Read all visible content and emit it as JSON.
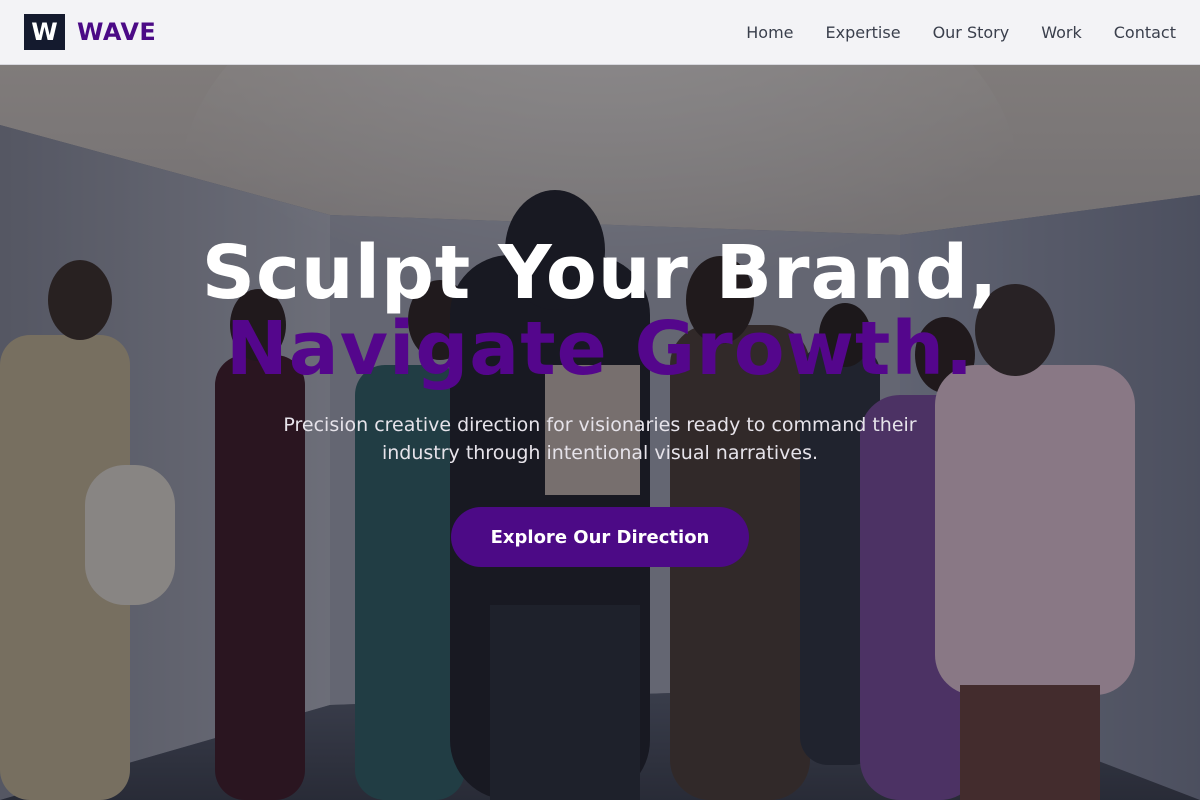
{
  "brand": {
    "logo_letter": "W",
    "name": "WAVE"
  },
  "nav": {
    "items": [
      {
        "label": "Home"
      },
      {
        "label": "Expertise"
      },
      {
        "label": "Our Story"
      },
      {
        "label": "Work"
      },
      {
        "label": "Contact"
      }
    ]
  },
  "hero": {
    "headline_line1": "Sculpt Your Brand,",
    "headline_line2": "Navigate Growth.",
    "subtitle": "Precision creative direction for visionaries ready to command their industry through intentional visual narratives.",
    "cta_label": "Explore Our Direction",
    "background_image": "fashion-group-photo"
  },
  "colors": {
    "accent": "#4c0a86",
    "logo_bg": "#141a2e",
    "header_bg": "#f3f3f6"
  }
}
